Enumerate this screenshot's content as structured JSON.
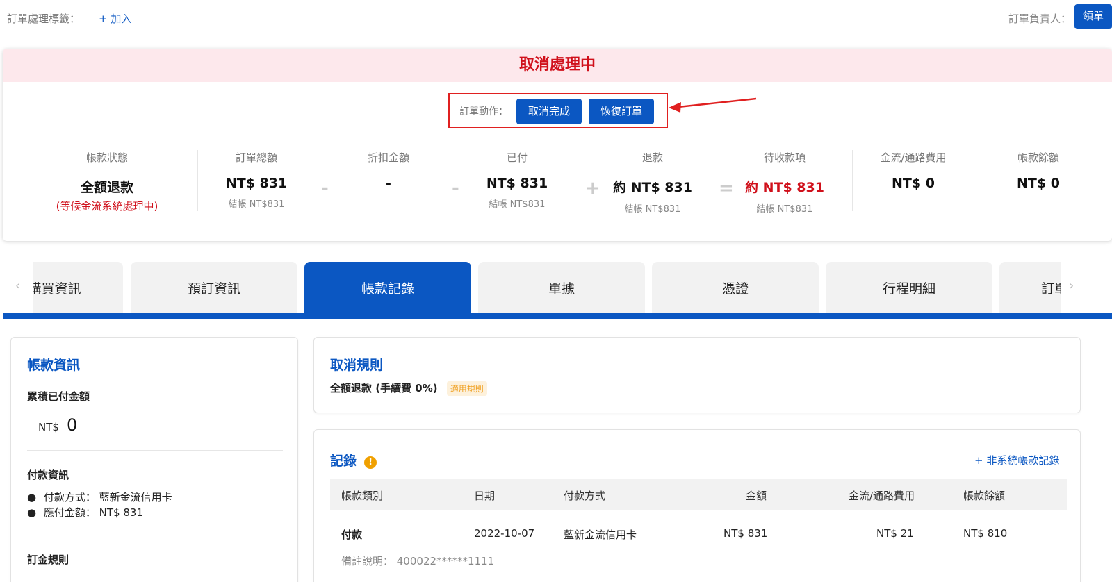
{
  "topbar": {
    "tag_label": "訂單處理標籤：",
    "tag_add": "+ 加入",
    "owner_label": "訂單負責人：",
    "claim_button": "領單"
  },
  "status": {
    "header": "取消處理中",
    "action_label": "訂單動作：",
    "cancel_complete_button": "取消完成",
    "restore_order_button": "恢復訂單"
  },
  "summary": {
    "account_status": {
      "title": "帳款狀態",
      "value": "全額退款",
      "note": "(等候金流系統處理中)"
    },
    "order_total": {
      "title": "訂單總額",
      "value": "NT$ 831",
      "sub": "結帳 NT$831"
    },
    "discount": {
      "title": "折扣金額",
      "value": "-"
    },
    "paid": {
      "title": "已付",
      "value": "NT$ 831",
      "sub": "結帳 NT$831"
    },
    "refund": {
      "title": "退款",
      "value": "約 NT$ 831",
      "sub": "結帳 NT$831"
    },
    "receivable": {
      "title": "待收款項",
      "value": "約 NT$ 831",
      "sub": "結帳 NT$831"
    },
    "gateway_fee": {
      "title": "金流/通路費用",
      "value": "NT$ 0"
    },
    "balance": {
      "title": "帳款餘額",
      "value": "NT$ 0"
    },
    "ops": [
      "-",
      "-",
      "+",
      "="
    ]
  },
  "tabs": [
    {
      "label": "購買資訊"
    },
    {
      "label": "預訂資訊"
    },
    {
      "label": "帳款記錄"
    },
    {
      "label": "單據"
    },
    {
      "label": "憑證"
    },
    {
      "label": "行程明細"
    },
    {
      "label": "訂單"
    }
  ],
  "account_info": {
    "title": "帳款資訊",
    "accumulated_label": "累積已付金額",
    "currency": "NT$",
    "accumulated_value": "0",
    "payment_info_label": "付款資訊",
    "payment_method": "付款方式： 藍新金流信用卡",
    "payable_amount": "應付金額： NT$ 831",
    "deposit_rules_label": "訂金規則"
  },
  "cancel_rules": {
    "title": "取消規則",
    "rule": "全額退款 (手續費 0%)",
    "badge": "適用規則"
  },
  "records": {
    "title": "記錄",
    "add_link": "+ 非系統帳款記錄",
    "headers": [
      "帳款類別",
      "日期",
      "付款方式",
      "金額",
      "金流/通路費用",
      "帳款餘額"
    ],
    "rows": [
      {
        "type": "付款",
        "date": "2022-10-07",
        "method": "藍新金流信用卡",
        "amount": "NT$ 831",
        "fee": "NT$ 21",
        "balance": "NT$ 810",
        "note": "備註說明： 400022******1111"
      }
    ]
  },
  "colors": {
    "primary": "#0b57c2",
    "danger": "#d0101b",
    "warning": "#f0a000",
    "header_bg": "#fde8ec"
  }
}
